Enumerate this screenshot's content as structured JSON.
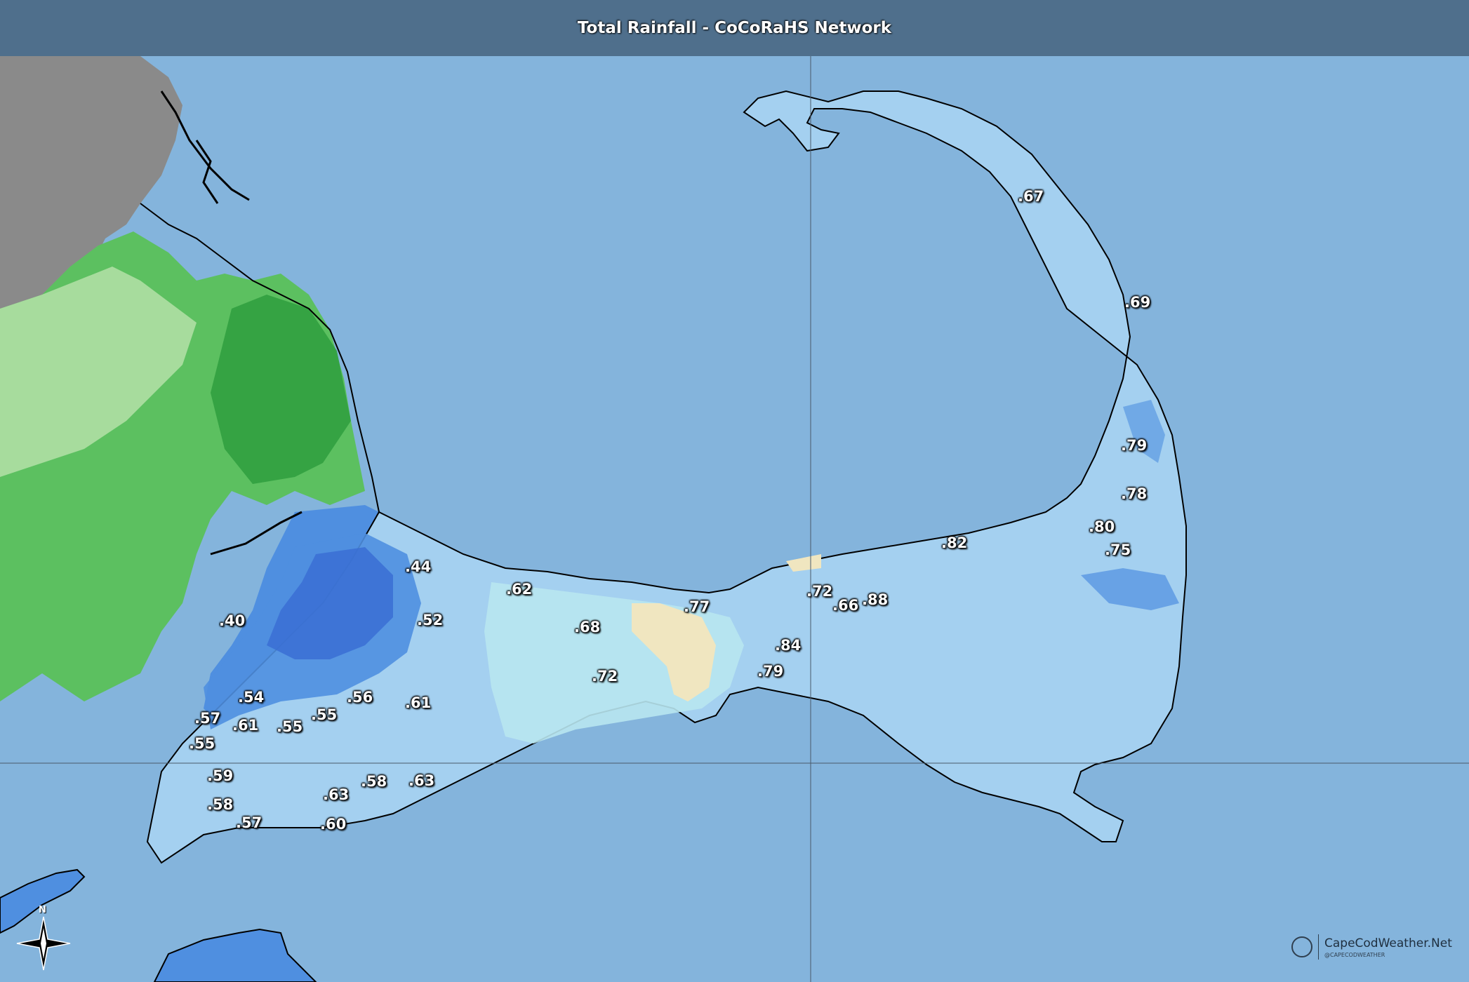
{
  "title": "Total Rainfall - CoCoRaHS Network",
  "colors": {
    "water": "#84b4dc",
    "title_bar": "#4f6f8c",
    "land_gray": "#8a8a8a",
    "light_green": "#b4e0a8",
    "green": "#5cc060",
    "dark_green": "#2e9e3e",
    "blue": "#4f8fe0",
    "dark_blue": "#3a6fd4",
    "light_blue": "#a4d0f0",
    "pale_cyan": "#b8e6f0",
    "tan": "#f0e6c0",
    "outline": "#000000"
  },
  "labels": [
    {
      "id": "label-67",
      "text": ".67"
    },
    {
      "id": "label-69",
      "text": ".69"
    },
    {
      "id": "label-79a",
      "text": ".79"
    },
    {
      "id": "label-78",
      "text": ".78"
    },
    {
      "id": "label-80",
      "text": ".80"
    },
    {
      "id": "label-75",
      "text": ".75"
    },
    {
      "id": "label-82",
      "text": ".82"
    },
    {
      "id": "label-72a",
      "text": ".72"
    },
    {
      "id": "label-66",
      "text": ".66"
    },
    {
      "id": "label-88",
      "text": ".88"
    },
    {
      "id": "label-84",
      "text": ".84"
    },
    {
      "id": "label-79b",
      "text": ".79"
    },
    {
      "id": "label-77",
      "text": ".77"
    },
    {
      "id": "label-62",
      "text": ".62"
    },
    {
      "id": "label-68",
      "text": ".68"
    },
    {
      "id": "label-72b",
      "text": ".72"
    },
    {
      "id": "label-44",
      "text": ".44"
    },
    {
      "id": "label-52",
      "text": ".52"
    },
    {
      "id": "label-40",
      "text": ".40"
    },
    {
      "id": "label-54",
      "text": ".54"
    },
    {
      "id": "label-56",
      "text": ".56"
    },
    {
      "id": "label-61a",
      "text": ".61"
    },
    {
      "id": "label-57a",
      "text": ".57"
    },
    {
      "id": "label-61b",
      "text": ".61"
    },
    {
      "id": "label-55a",
      "text": ".55"
    },
    {
      "id": "label-55b",
      "text": ".55"
    },
    {
      "id": "label-55c",
      "text": ".55"
    },
    {
      "id": "label-59",
      "text": ".59"
    },
    {
      "id": "label-58a",
      "text": ".58"
    },
    {
      "id": "label-57b",
      "text": ".57"
    },
    {
      "id": "label-63a",
      "text": ".63"
    },
    {
      "id": "label-58b",
      "text": ".58"
    },
    {
      "id": "label-63b",
      "text": ".63"
    },
    {
      "id": "label-60",
      "text": ".60"
    }
  ],
  "compass": {
    "north_label": "N"
  },
  "brand": {
    "name": "CapeCodWeather.Net",
    "sub": "@CAPECODWEATHER"
  }
}
